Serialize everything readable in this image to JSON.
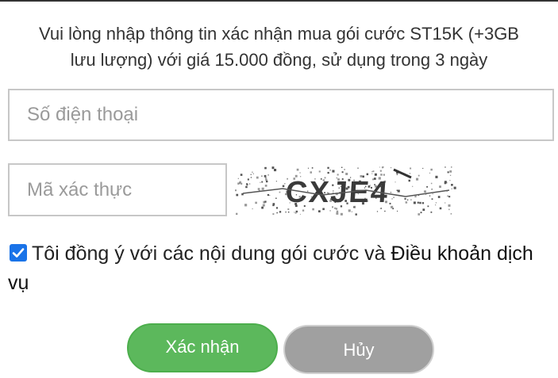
{
  "dialog": {
    "message_line1": "Vui lòng nhập thông tin xác nhận mua gói cước ST15K (+3GB",
    "message_line2": "lưu lượng) với giá 15.000 đồng, sử dụng trong 3 ngày"
  },
  "form": {
    "phone_placeholder": "Số điện thoại",
    "phone_value": "",
    "captcha_placeholder": "Mã xác thực",
    "captcha_value": "",
    "captcha_image_text": "CXJE4"
  },
  "agreement": {
    "checked": true,
    "text": "Tôi đồng ý với các nội dung gói cước và ",
    "link_label": "Điều khoản dịch vụ"
  },
  "buttons": {
    "confirm_label": "Xác nhận",
    "cancel_label": "Hủy"
  },
  "colors": {
    "confirm": "#5cb85c",
    "cancel": "#a0a0a0",
    "checkbox": "#1a73e8"
  },
  "icons": {
    "checkbox": "check-icon"
  }
}
